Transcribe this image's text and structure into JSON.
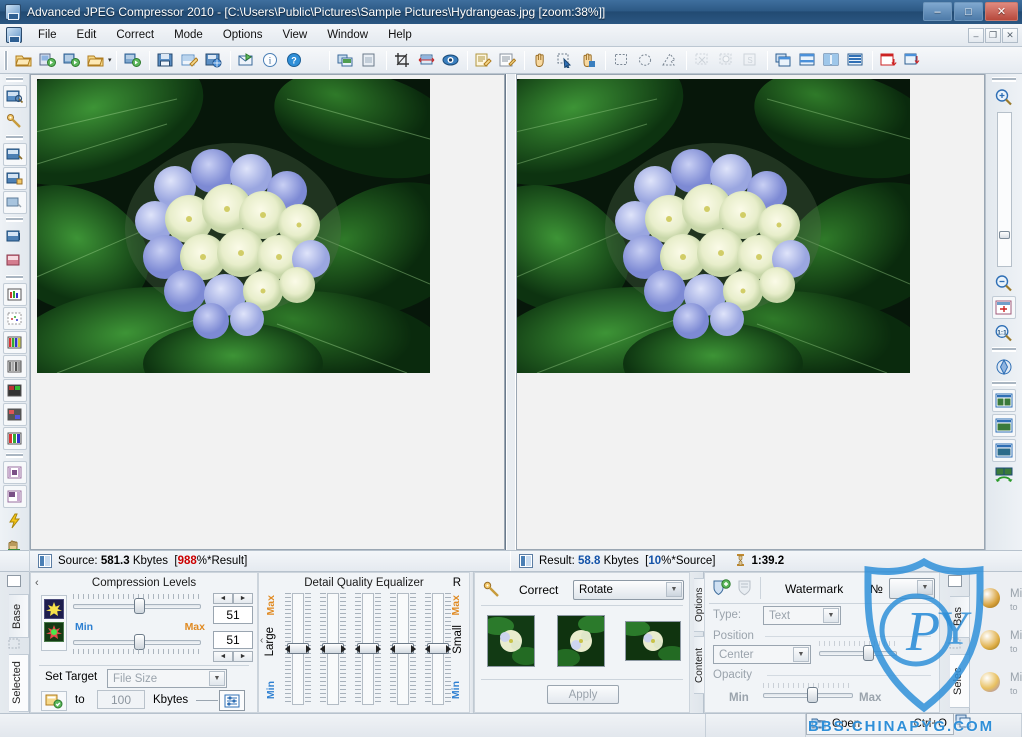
{
  "window": {
    "title": "Advanced JPEG Compressor 2010 - [C:\\Users\\Public\\Pictures\\Sample Pictures\\Hydrangeas.jpg  [zoom:38%]]",
    "minimize": "–",
    "maximize": "□",
    "close": "✕"
  },
  "mdi": {
    "minimize": "–",
    "restore": "❐",
    "close": "✕"
  },
  "menu": {
    "items": [
      {
        "label": "File"
      },
      {
        "label": "Edit"
      },
      {
        "label": "Correct"
      },
      {
        "label": "Mode"
      },
      {
        "label": "Options"
      },
      {
        "label": "View"
      },
      {
        "label": "Window"
      },
      {
        "label": "Help"
      }
    ]
  },
  "toolbar": {
    "groups": [
      {
        "buttons": [
          {
            "name": "open-file",
            "glyph": "📂"
          },
          {
            "name": "open-batch",
            "glyph": "🗂"
          },
          {
            "name": "reopen-image",
            "glyph": "↻"
          },
          {
            "name": "open-recent",
            "glyph": "📁",
            "dropdown": true
          },
          {
            "name": "open-folder",
            "glyph": "📁"
          }
        ]
      },
      {
        "buttons": [
          {
            "name": "save",
            "glyph": "💾"
          },
          {
            "name": "save-as",
            "glyph": "📝"
          },
          {
            "name": "save-for-web",
            "glyph": "🌐"
          },
          {
            "name": "send-mail",
            "glyph": "✉"
          },
          {
            "name": "image-info",
            "glyph": "i"
          },
          {
            "name": "help",
            "glyph": "?"
          }
        ]
      },
      {
        "buttons": [
          {
            "name": "copy-image",
            "glyph": "⧉"
          },
          {
            "name": "paste-image",
            "glyph": "📋"
          }
        ]
      },
      {
        "buttons": [
          {
            "name": "crop-tool",
            "glyph": "⌗"
          },
          {
            "name": "resize-image",
            "glyph": "↔"
          },
          {
            "name": "color-correct",
            "glyph": "◉"
          },
          {
            "name": "edit-notes",
            "glyph": "✎"
          },
          {
            "name": "edit-comment",
            "glyph": "✍"
          }
        ]
      },
      {
        "buttons": [
          {
            "name": "pan-tool",
            "glyph": "✋"
          },
          {
            "name": "select-tool",
            "glyph": "⬚"
          },
          {
            "name": "hand-color-tool",
            "glyph": "🖐"
          }
        ]
      },
      {
        "buttons": [
          {
            "name": "rect-selection",
            "glyph": "▭"
          },
          {
            "name": "ellipse-selection",
            "glyph": "◯"
          },
          {
            "name": "lasso-selection",
            "glyph": "◺"
          },
          {
            "name": "clear-selection",
            "glyph": "✳",
            "disabled": true
          },
          {
            "name": "invert-selection",
            "glyph": "❋",
            "disabled": true
          },
          {
            "name": "save-selection",
            "glyph": "⎙",
            "disabled": true
          }
        ]
      },
      {
        "buttons": [
          {
            "name": "view-cascade",
            "glyph": "❐"
          },
          {
            "name": "view-horizontal",
            "glyph": "▤"
          },
          {
            "name": "view-vertical",
            "glyph": "▥"
          },
          {
            "name": "view-tiled",
            "glyph": "▦"
          },
          {
            "name": "close-window",
            "glyph": "▣"
          },
          {
            "name": "close-all-windows",
            "glyph": "⊡"
          }
        ]
      }
    ]
  },
  "left_strip": {
    "buttons": [
      {
        "name": "compress-image",
        "glyph": "▣"
      },
      {
        "name": "correct-image",
        "glyph": "🔑"
      },
      {
        "name": "batch-compress",
        "glyph": "▤"
      },
      {
        "name": "lock-compress",
        "glyph": "🔒"
      },
      {
        "name": "preview-compress",
        "glyph": "▭"
      },
      {
        "name": "compare-images",
        "glyph": "▥"
      },
      {
        "name": "difference-map",
        "glyph": "▨"
      },
      {
        "name": "histogram-rgb",
        "glyph": "▥"
      },
      {
        "name": "histogram-scatter",
        "glyph": "▩"
      },
      {
        "name": "color-bars",
        "glyph": "▮"
      },
      {
        "name": "gray-bars",
        "glyph": "▮"
      },
      {
        "name": "gradient-1",
        "glyph": "▤"
      },
      {
        "name": "gradient-2",
        "glyph": "▤"
      },
      {
        "name": "gradient-3",
        "glyph": "▤"
      },
      {
        "name": "film-strip-1",
        "glyph": "▦"
      },
      {
        "name": "film-strip-2",
        "glyph": "▦"
      },
      {
        "name": "quick-action",
        "glyph": "⚡"
      },
      {
        "name": "paint-tool",
        "glyph": "✋"
      }
    ]
  },
  "right_strip": {
    "zoom_in": "＋",
    "zoom_out": "－",
    "buttons": [
      {
        "name": "fit-to-window",
        "glyph": "⤢"
      },
      {
        "name": "actual-size",
        "glyph": "1:1"
      },
      {
        "name": "navigator",
        "glyph": "◈"
      },
      {
        "name": "layout-single",
        "glyph": "▭"
      },
      {
        "name": "layout-split-h",
        "glyph": "▤"
      },
      {
        "name": "layout-split-v",
        "glyph": "▥"
      },
      {
        "name": "swap-images",
        "glyph": "⇄"
      }
    ]
  },
  "status": {
    "source_label": "Source:",
    "source_size": "581.3",
    "source_unit": "Kbytes",
    "source_ratio_open": "[",
    "source_ratio_value": "988",
    "source_ratio_rest": "%*Result]",
    "result_label": "Result:",
    "result_size": "58.8",
    "result_unit": "Kbytes",
    "result_ratio_open": "[",
    "result_ratio_value": "10",
    "result_ratio_rest": "%*Source]",
    "compression_ratio": "1:39.2"
  },
  "left_vtabs": {
    "top_label": "Base",
    "bottom_label": "Selected"
  },
  "compression": {
    "title": "Compression Levels",
    "collapse_glyph": "‹",
    "min_label": "Min",
    "max_label": "Max",
    "value_top": "51",
    "value_bottom": "51",
    "set_target_label": "Set Target",
    "target_mode": "File Size",
    "to_label": "to",
    "target_value": "100",
    "target_unit": "Kbytes"
  },
  "equalizer": {
    "title": "Detail Quality Equalizer",
    "r_label": "R",
    "left_max": "Max",
    "left_min": "Min",
    "right_max": "Max",
    "right_min": "Min",
    "large_label": "Large",
    "small_label": "Small",
    "collapse_glyph": "‹",
    "sliders": [
      50,
      50,
      50,
      50,
      50
    ]
  },
  "correct": {
    "title": "Correct",
    "mode": "Rotate",
    "apply_label": "Apply",
    "vtab_options": "Options",
    "vtab_content": "Content",
    "thumbs": [
      "rotate-left-preview",
      "rotate-none-preview",
      "rotate-right-preview"
    ]
  },
  "watermark": {
    "title": "Watermark",
    "number_label": "№",
    "number_value": "",
    "type_label": "Type:",
    "type_value": "Text",
    "position_label": "Position",
    "position_value": "Center",
    "opacity_label": "Opacity",
    "opacity_min": "Min",
    "opacity_max": "Max",
    "add_icon": "add-watermark-icon",
    "remove_icon": "remove-watermark-icon",
    "vtab_base": "Bas",
    "vtab_select": "Selec"
  },
  "right_vtabs": {
    "base": "Bas",
    "select": "Selec"
  },
  "hidden_panel": {
    "rows": [
      {
        "min_label": "Mi",
        "to_label": "to"
      },
      {
        "min_label": "Mi",
        "to_label": "to"
      },
      {
        "min_label": "Mi",
        "to_label": "to"
      }
    ]
  },
  "context_menu": {
    "item_label": "Open",
    "shortcut": "Ctrl+O"
  },
  "watermark_overlay": {
    "text": "BBS.CHINAPYG.COM",
    "shield_letters": "PYG",
    "color": "#2f8fd8"
  }
}
